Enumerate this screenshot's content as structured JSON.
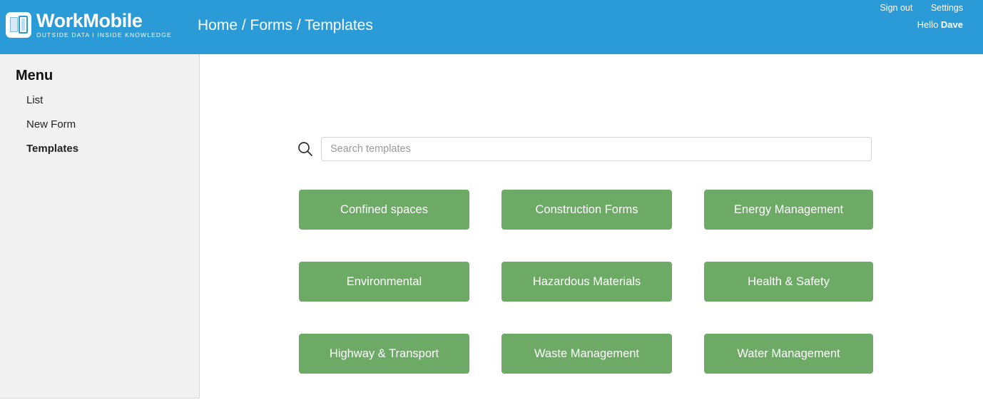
{
  "header": {
    "brand": {
      "name": "WorkMobile",
      "tagline": "OUTSIDE DATA I INSIDE KNOWLEDGE",
      "icon": "document-tablet-icon"
    },
    "breadcrumb": "Home / Forms / Templates",
    "sign_out_label": "Sign out",
    "settings_label": "Settings",
    "greeting_prefix": "Hello ",
    "user_name": "Dave",
    "background_color": "#2b9bd8"
  },
  "sidebar": {
    "title": "Menu",
    "background_color": "#f1f1f1",
    "items": [
      {
        "label": "List",
        "active": false
      },
      {
        "label": "New Form",
        "active": false
      },
      {
        "label": "Templates",
        "active": true
      }
    ]
  },
  "main": {
    "search": {
      "icon": "search-icon",
      "placeholder": "Search templates",
      "value": ""
    },
    "templates_button_color": "#6daa66",
    "templates": [
      {
        "label": "Confined spaces"
      },
      {
        "label": "Construction Forms"
      },
      {
        "label": "Energy Management"
      },
      {
        "label": "Environmental"
      },
      {
        "label": "Hazardous Materials"
      },
      {
        "label": "Health & Safety"
      },
      {
        "label": "Highway & Transport"
      },
      {
        "label": "Waste Management"
      },
      {
        "label": "Water Management"
      }
    ]
  }
}
